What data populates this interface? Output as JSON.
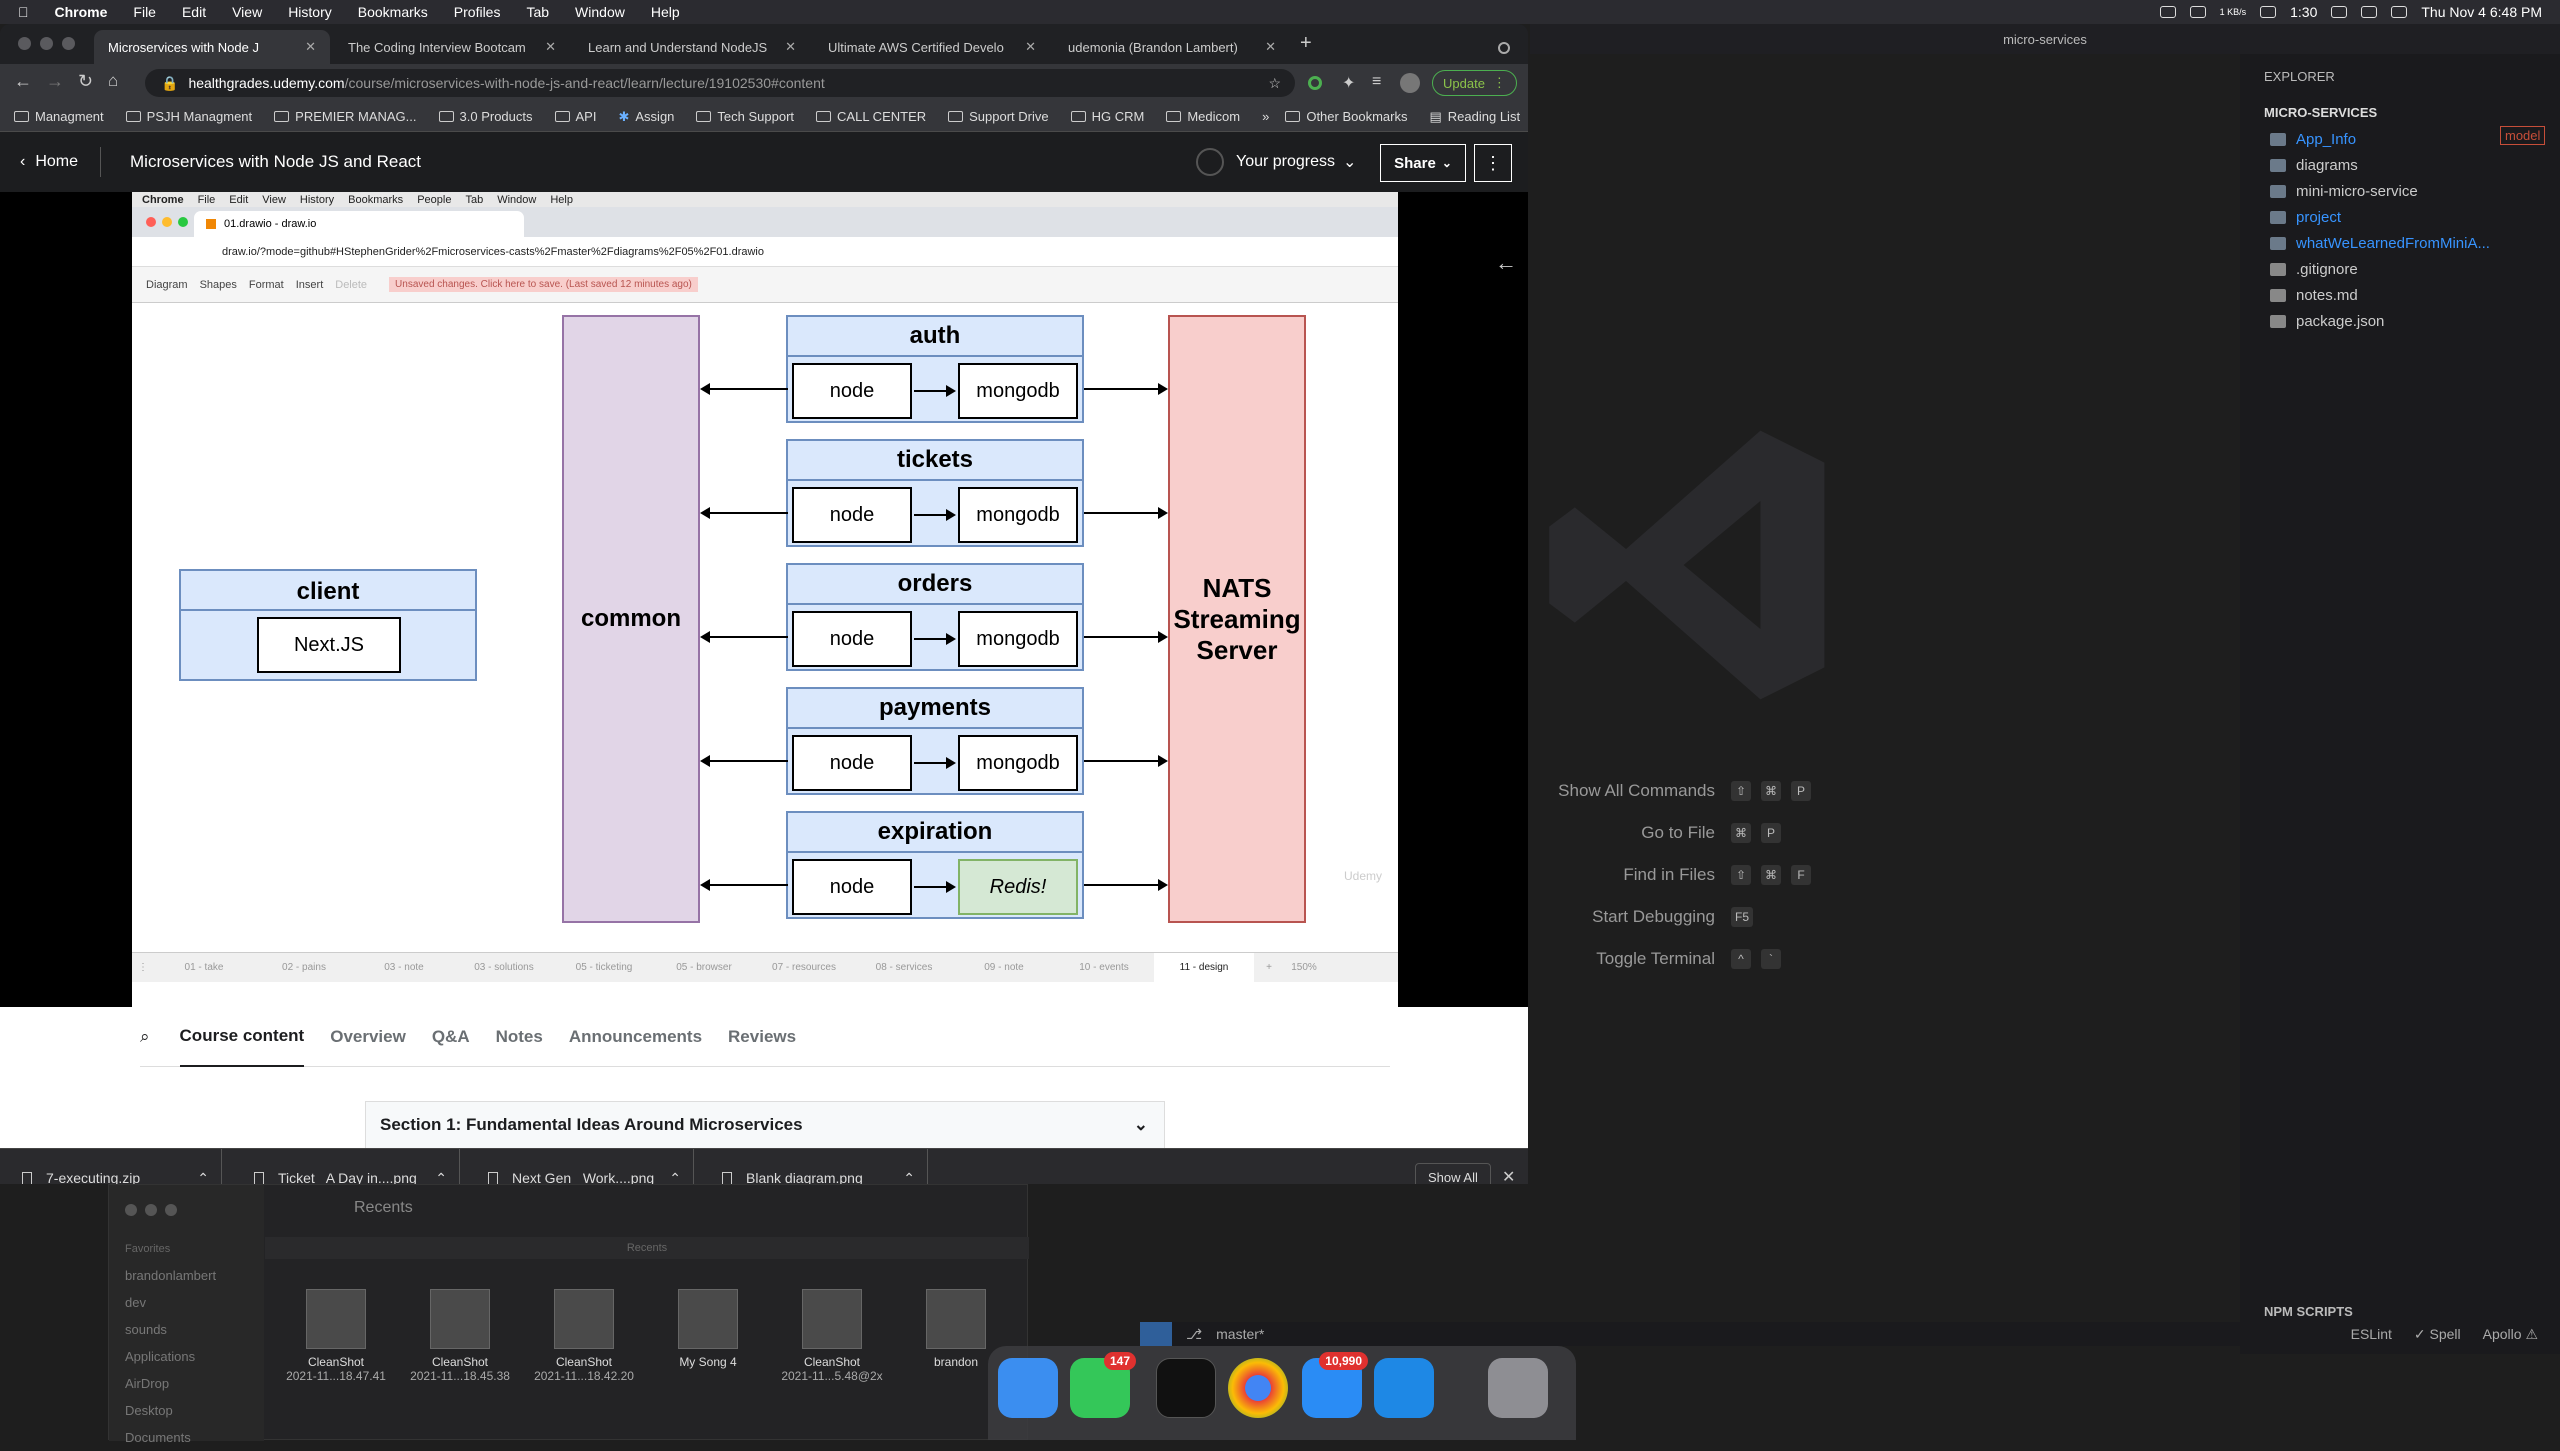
{
  "menubar": {
    "app": "Chrome",
    "items": [
      "File",
      "Edit",
      "View",
      "History",
      "Bookmarks",
      "Profiles",
      "Tab",
      "Window",
      "Help"
    ],
    "net": "1 KB/s",
    "time_small": "1:30",
    "datetime": "Thu Nov 4  6:48 PM"
  },
  "chrome": {
    "tabs": [
      {
        "title": "Microservices with Node J"
      },
      {
        "title": "The Coding Interview Bootcam"
      },
      {
        "title": "Learn and Understand NodeJS"
      },
      {
        "title": "Ultimate AWS Certified Develo"
      },
      {
        "title": "udemonia (Brandon Lambert)"
      }
    ],
    "url_host": "healthgrades.udemy.com",
    "url_path": "/course/microservices-with-node-js-and-react/learn/lecture/19102530#content",
    "update_label": "Update",
    "bookmarks": [
      "Managment",
      "PSJH Managment",
      "PREMIER MANAG...",
      "3.0 Products",
      "API",
      "Assign",
      "Tech Support",
      "CALL CENTER",
      "Support Drive",
      "HG CRM",
      "Medicom"
    ],
    "other_bookmarks": "Other Bookmarks",
    "reading_list": "Reading List"
  },
  "udemy": {
    "home": "Home",
    "course_title": "Microservices with Node JS and React",
    "progress": "Your progress",
    "share": "Share",
    "tabs": [
      "Course content",
      "Overview",
      "Q&A",
      "Notes",
      "Announcements",
      "Reviews"
    ],
    "section": "Section 1: Fundamental Ideas Around Microservices"
  },
  "inner": {
    "menubar": [
      "Chrome",
      "File",
      "Edit",
      "View",
      "History",
      "Bookmarks",
      "People",
      "Tab",
      "Window",
      "Help"
    ],
    "tab_title": "01.drawio - draw.io",
    "url": "draw.io/?mode=github#HStephenGrider%2Fmicroservices-casts%2Fmaster%2Fdiagrams%2F05%2F01.drawio",
    "toolbar": [
      "Diagram",
      "Shapes",
      "Format",
      "Insert",
      "Delete"
    ],
    "unsaved": "Unsaved changes. Click here to save. (Last saved 12 minutes ago)",
    "pages": [
      "01 - take",
      "02 - pains",
      "03 - note",
      "03 - solutions",
      "05 - ticketing",
      "05 - browser",
      "07 - resources",
      "08 - services",
      "09 - note",
      "10 - events",
      "11 - design"
    ],
    "zoom": "150%",
    "watermark": "Udemy"
  },
  "diagram": {
    "client": {
      "title": "client",
      "inner": "Next.JS"
    },
    "common": "common",
    "nats": "NATS Streaming Server",
    "services": [
      {
        "name": "auth",
        "app": "node",
        "db": "mongodb"
      },
      {
        "name": "tickets",
        "app": "node",
        "db": "mongodb"
      },
      {
        "name": "orders",
        "app": "node",
        "db": "mongodb"
      },
      {
        "name": "payments",
        "app": "node",
        "db": "mongodb"
      },
      {
        "name": "expiration",
        "app": "node",
        "db": "Redis!"
      }
    ]
  },
  "downloads": [
    {
      "name": "7-executing.zip"
    },
    {
      "name": "Ticket_ A Day in....png"
    },
    {
      "name": "Next Gen_ Work....png"
    },
    {
      "name": "Blank diagram.png"
    }
  ],
  "downloads_show_all": "Show All",
  "finder": {
    "title": "Recents",
    "section_label": "Recents",
    "sidebar_head": "Favorites",
    "sidebar": [
      "brandonlambert",
      "dev",
      "sounds",
      "Applications",
      "AirDrop",
      "Desktop",
      "Documents"
    ],
    "items": [
      {
        "line1": "CleanShot",
        "line2": "2021-11...18.47.41"
      },
      {
        "line1": "CleanShot",
        "line2": "2021-11...18.45.38"
      },
      {
        "line1": "CleanShot",
        "line2": "2021-11...18.42.20"
      },
      {
        "line1": "My Song 4",
        "line2": ""
      },
      {
        "line1": "CleanShot",
        "line2": "2021-11...5.48@2x"
      },
      {
        "line1": "brandon",
        "line2": ""
      }
    ]
  },
  "dock": {
    "messages_badge": "147",
    "mail_badge": "10,990"
  },
  "vscode": {
    "window_title": "micro-services",
    "explorer": "EXPLORER",
    "project": "MICRO-SERVICES",
    "tree": [
      {
        "name": "App_Info",
        "color": "#3794ff"
      },
      {
        "name": "diagrams",
        "color": "#cccccc"
      },
      {
        "name": "mini-micro-service",
        "color": "#cccccc"
      },
      {
        "name": "project",
        "color": "#3794ff"
      },
      {
        "name": "whatWeLearnedFromMiniA...",
        "color": "#3794ff"
      },
      {
        "name": ".gitignore",
        "color": "#cccccc"
      },
      {
        "name": "notes.md",
        "color": "#cccccc"
      },
      {
        "name": "package.json",
        "color": "#cccccc"
      }
    ],
    "model_badge": "model",
    "npm_scripts": "NPM SCRIPTS",
    "commands": [
      {
        "label": "Show All Commands",
        "keys": [
          "⇧",
          "⌘",
          "P"
        ]
      },
      {
        "label": "Go to File",
        "keys": [
          "⌘",
          "P"
        ]
      },
      {
        "label": "Find in Files",
        "keys": [
          "⇧",
          "⌘",
          "F"
        ]
      },
      {
        "label": "Start Debugging",
        "keys": [
          "F5"
        ]
      },
      {
        "label": "Toggle Terminal",
        "keys": [
          "^",
          "`"
        ]
      }
    ],
    "status": {
      "branch": "master*",
      "eslint": "ESLint",
      "spell": "✓ Spell",
      "apollo": "Apollo ⚠"
    }
  }
}
